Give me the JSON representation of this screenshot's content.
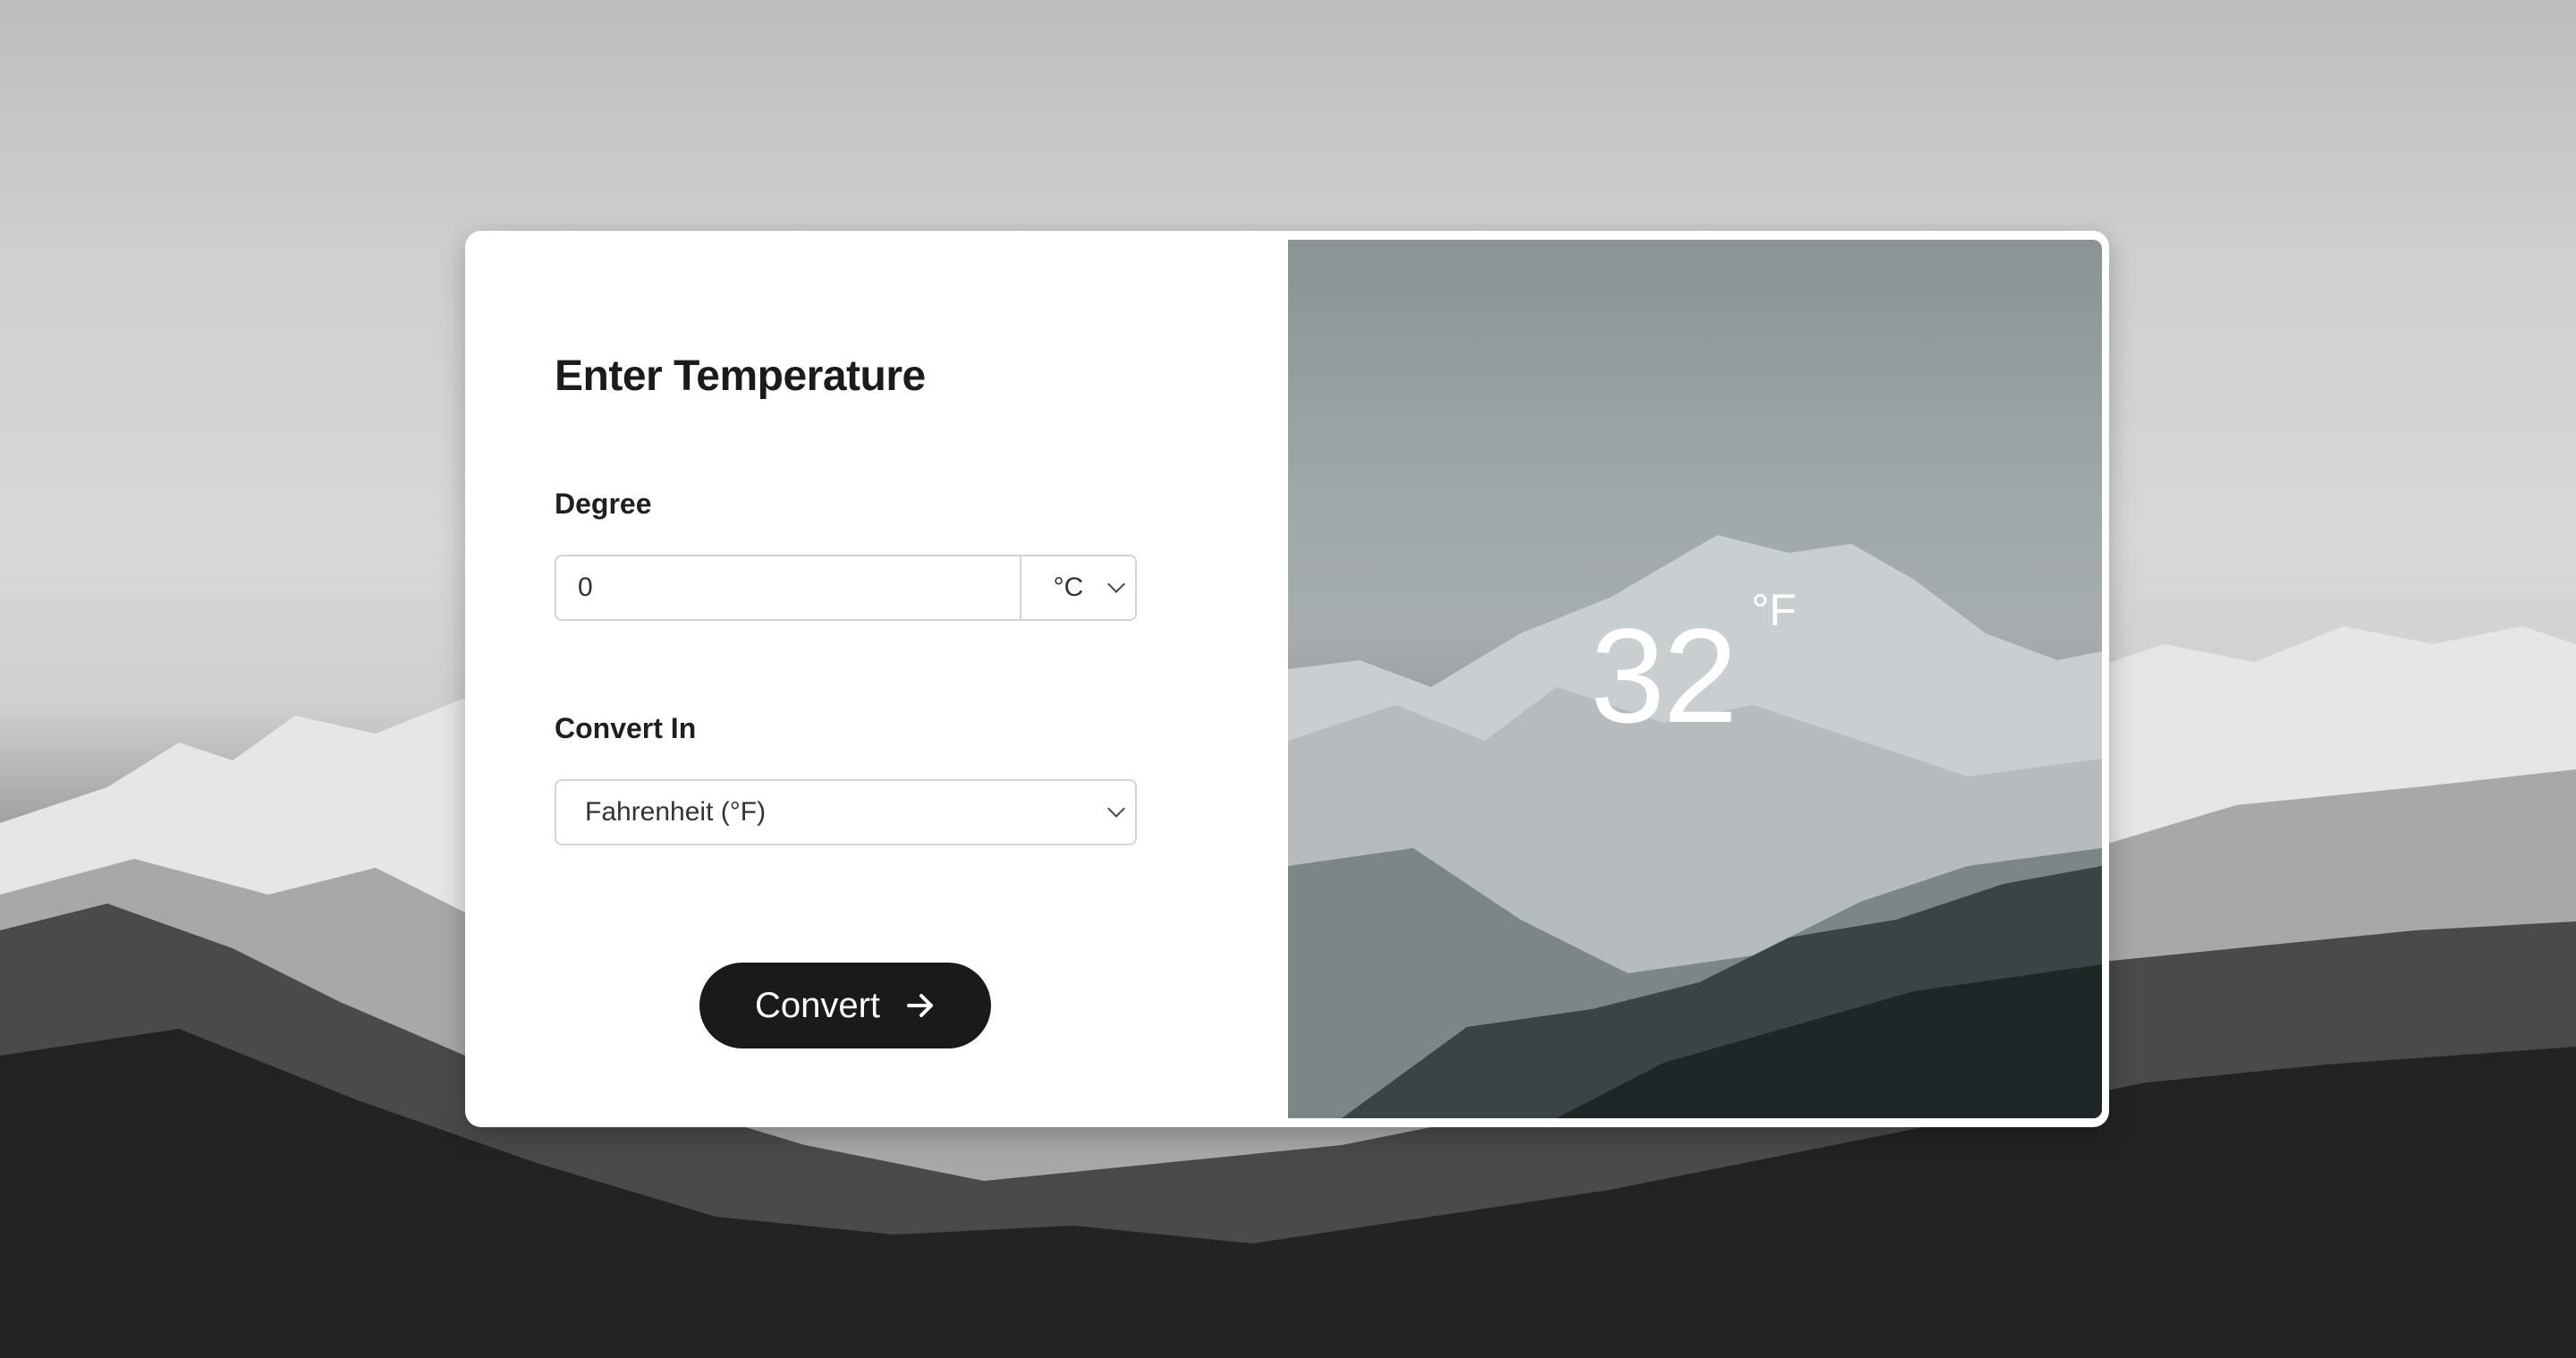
{
  "form": {
    "heading": "Enter Temperature",
    "degree_label": "Degree",
    "degree_value": "0",
    "unit_selected": "°C",
    "convert_in_label": "Convert In",
    "target_selected": "Fahrenheit (°F)",
    "button_label": "Convert"
  },
  "result": {
    "value": "32",
    "unit": "°F"
  },
  "icons": {
    "button_arrow": "arrow-right-icon",
    "dropdown": "chevron-down-icon"
  },
  "colors": {
    "button_bg": "#1a1a1a",
    "card_bg": "#ffffff",
    "text": "#1b1b1b"
  }
}
